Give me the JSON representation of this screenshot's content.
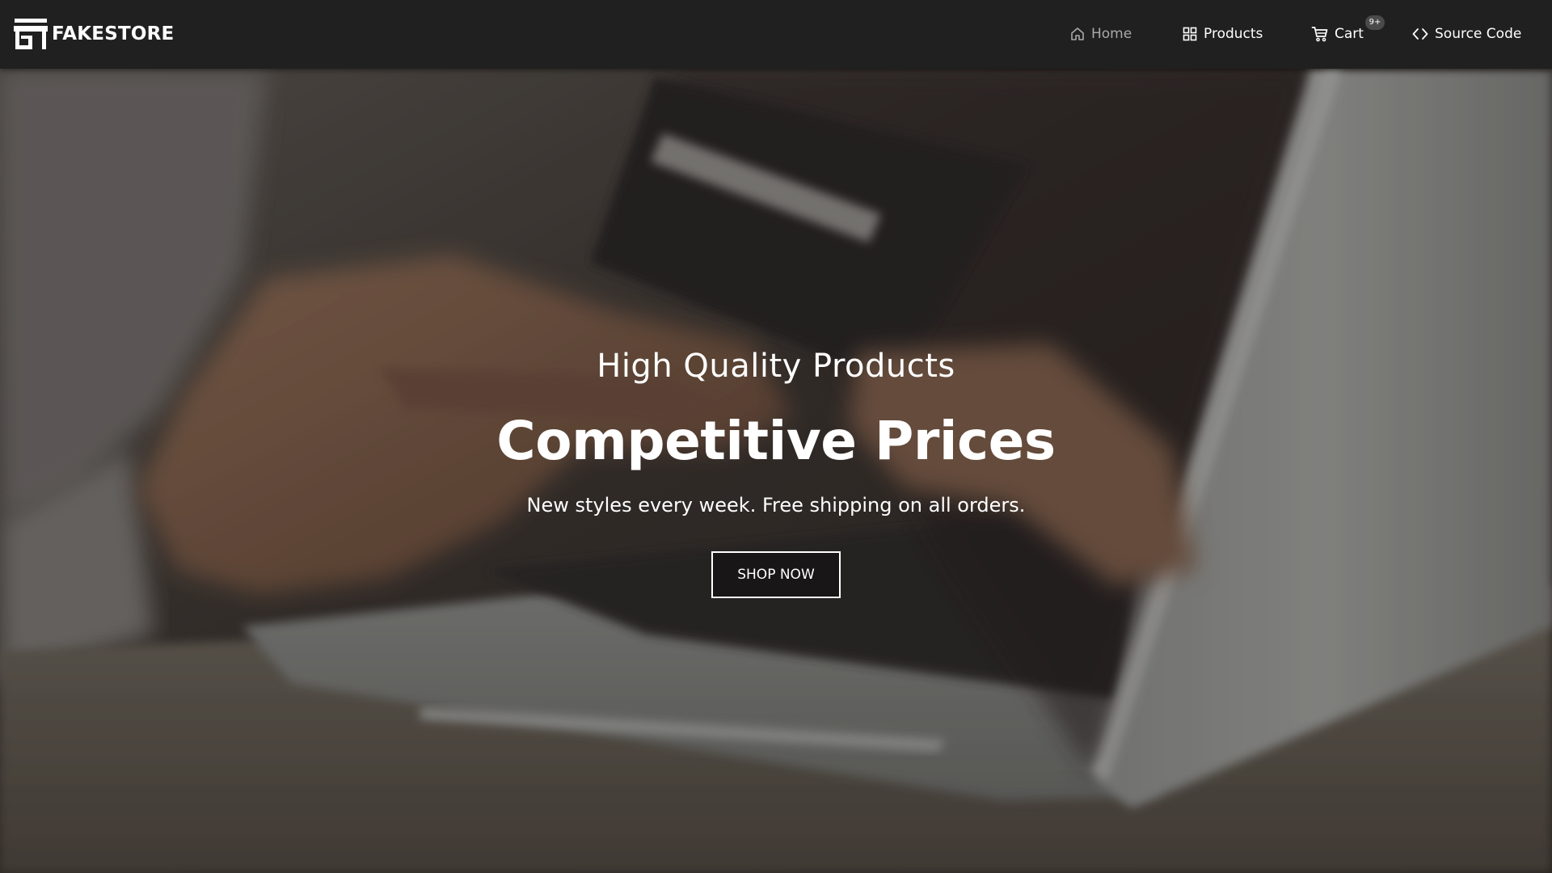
{
  "navbar": {
    "brand": {
      "name": "FAKESTORE",
      "icon": "storefront-icon"
    },
    "items": [
      {
        "label": "Home",
        "icon": "home-icon",
        "color": "#a9a9a9"
      },
      {
        "label": "Products",
        "icon": "grid-icon"
      },
      {
        "label": "Cart",
        "icon": "cart-icon",
        "badge": "9+"
      },
      {
        "label": "Source Code",
        "icon": "code-icon"
      }
    ]
  },
  "hero": {
    "subtitle": "High Quality Products",
    "title": "Competitive Prices",
    "text": "New styles every week. Free shipping on all orders.",
    "cta_label": "SHOP NOW"
  },
  "colors": {
    "navbar_bg": "#202020",
    "text": "#ffffff",
    "muted": "#a9a9a9"
  }
}
